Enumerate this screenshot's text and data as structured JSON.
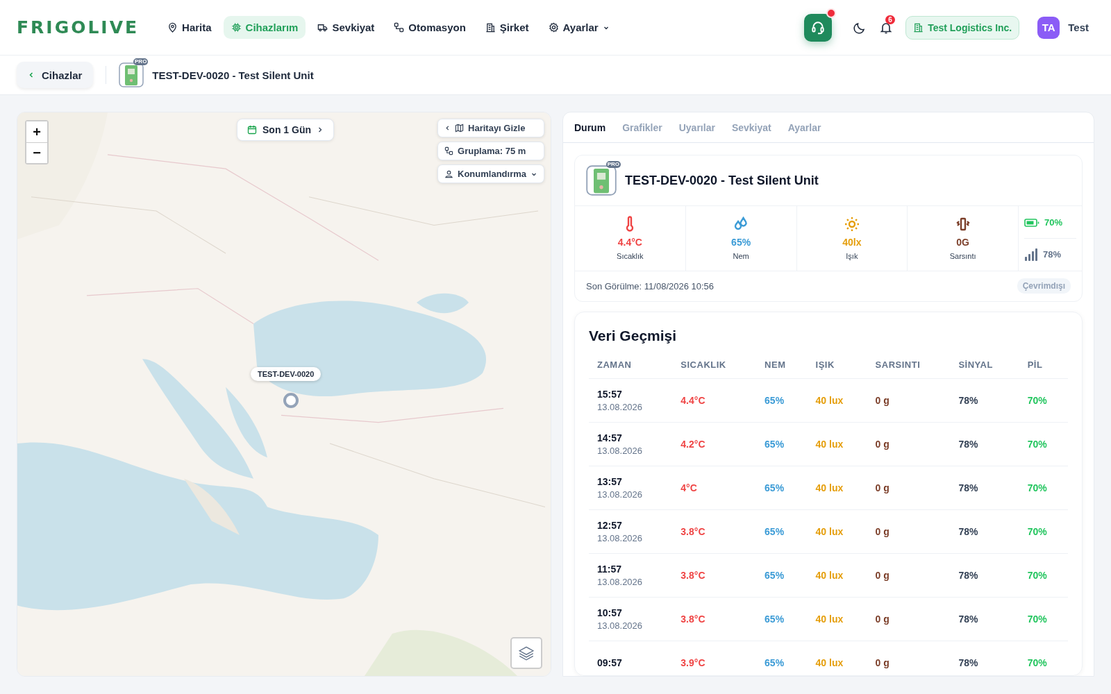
{
  "brand": "FRIGOLIVE",
  "nav": [
    {
      "label": "Harita",
      "kind": "map",
      "selected": false
    },
    {
      "label": "Cihazlarım",
      "kind": "devices",
      "selected": true
    },
    {
      "label": "Sevkiyat",
      "kind": "shipments",
      "selected": false
    },
    {
      "label": "Otomasyon",
      "kind": "automation",
      "selected": false
    },
    {
      "label": "Şirket",
      "kind": "company",
      "selected": false
    },
    {
      "label": "Ayarlar",
      "kind": "settings",
      "selected": false,
      "dropdown": true
    }
  ],
  "support": {
    "unread": true
  },
  "notifications": {
    "count": "6"
  },
  "company": "Test Logistics Inc.",
  "user": {
    "initials": "TA",
    "name": "Test"
  },
  "breadcrumb": {
    "back": "Cihazlar",
    "badge": "PRO",
    "title": "TEST-DEV-0020 - Test Silent Unit"
  },
  "map": {
    "zoom_in": "+",
    "zoom_out": "−",
    "range": "Son 1 Gün",
    "hide": "Haritayı Gizle",
    "grouping": "Gruplama: 75 m",
    "positioning": "Konumlandırma",
    "marker": "TEST-DEV-0020"
  },
  "tabs": [
    {
      "label": "Durum",
      "selected": true
    },
    {
      "label": "Grafikler",
      "selected": false
    },
    {
      "label": "Uyarılar",
      "selected": false
    },
    {
      "label": "Sevkiyat",
      "selected": false
    },
    {
      "label": "Ayarlar",
      "selected": false
    }
  ],
  "device": {
    "badge": "PRO",
    "title": "TEST-DEV-0020 - Test Silent Unit",
    "metrics": [
      {
        "kind": "temp",
        "value": "4.4°C",
        "label": "Sıcaklık",
        "color": "#ef4444"
      },
      {
        "kind": "humidity",
        "value": "65%",
        "label": "Nem",
        "color": "#3b9bd6"
      },
      {
        "kind": "light",
        "value": "40lx",
        "label": "Işık",
        "color": "#e59e0b"
      },
      {
        "kind": "shock",
        "value": "0G",
        "label": "Sarsıntı",
        "color": "#7c3f2a"
      }
    ],
    "battery": "70%",
    "signal": "78%",
    "last_seen": "Son Görülme: 11/08/2026 10:56",
    "status": "Çevrimdışı",
    "online": false
  },
  "history": {
    "title": "Veri Geçmişi",
    "columns": [
      "ZAMAN",
      "SICAKLIK",
      "NEM",
      "IŞIK",
      "SARSINTI",
      "SİNYAL",
      "PİL"
    ],
    "rows": [
      {
        "time": "15:57",
        "date": "13.08.2026",
        "temp": "4.4°C",
        "hum": "65%",
        "light": "40 lux",
        "shock": "0 g",
        "signal": "78%",
        "battery": "70%"
      },
      {
        "time": "14:57",
        "date": "13.08.2026",
        "temp": "4.2°C",
        "hum": "65%",
        "light": "40 lux",
        "shock": "0 g",
        "signal": "78%",
        "battery": "70%"
      },
      {
        "time": "13:57",
        "date": "13.08.2026",
        "temp": "4°C",
        "hum": "65%",
        "light": "40 lux",
        "shock": "0 g",
        "signal": "78%",
        "battery": "70%"
      },
      {
        "time": "12:57",
        "date": "13.08.2026",
        "temp": "3.8°C",
        "hum": "65%",
        "light": "40 lux",
        "shock": "0 g",
        "signal": "78%",
        "battery": "70%"
      },
      {
        "time": "11:57",
        "date": "13.08.2026",
        "temp": "3.8°C",
        "hum": "65%",
        "light": "40 lux",
        "shock": "0 g",
        "signal": "78%",
        "battery": "70%"
      },
      {
        "time": "10:57",
        "date": "13.08.2026",
        "temp": "3.8°C",
        "hum": "65%",
        "light": "40 lux",
        "shock": "0 g",
        "signal": "78%",
        "battery": "70%"
      },
      {
        "time": "09:57",
        "temp": "3.9°C",
        "hum": "65%",
        "light": "40 lux",
        "shock": "0 g",
        "signal": "78%",
        "battery": "70%"
      }
    ]
  }
}
